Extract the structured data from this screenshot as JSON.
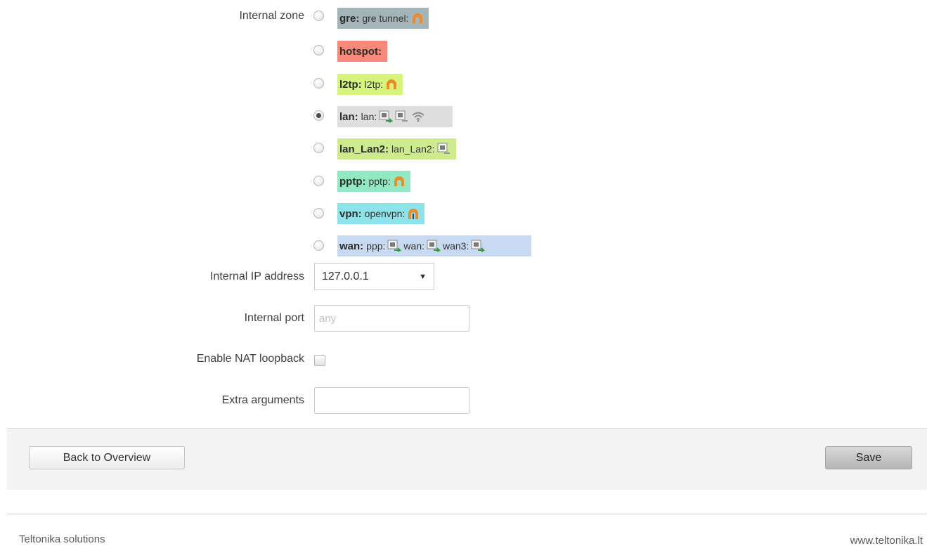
{
  "form": {
    "internal_zone_label": "Internal zone",
    "zones": [
      {
        "name": "gre:",
        "detail": "gre tunnel:",
        "color": "#a3b5b8",
        "icons": [
          "tunnel-icon"
        ],
        "checked": false
      },
      {
        "name": "hotspot:",
        "detail": "",
        "color": "#f7897a",
        "icons": [],
        "checked": false
      },
      {
        "name": "l2tp:",
        "detail": "l2tp:",
        "color": "#d6f57d",
        "icons": [
          "tunnel-icon"
        ],
        "checked": false
      },
      {
        "name": "lan:",
        "detail": "lan:",
        "color": "#dedede",
        "icons": [
          "ethernet-port-icon",
          "ethernet-port-icon",
          "wifi-icon"
        ],
        "checked": true
      },
      {
        "name": "lan_Lan2:",
        "detail": "lan_Lan2:",
        "color": "#cdea8c",
        "icons": [
          "ethernet-port-icon"
        ],
        "checked": false
      },
      {
        "name": "pptp:",
        "detail": "pptp:",
        "color": "#91e8c3",
        "icons": [
          "tunnel-icon"
        ],
        "checked": false
      },
      {
        "name": "vpn:",
        "detail": "openvpn:",
        "color": "#8ce4ea",
        "icons": [
          "vpn-tunnel-icon"
        ],
        "checked": false
      },
      {
        "name": "wan:",
        "detail": "ppp:",
        "detail2": "wan:",
        "detail3": "wan3:",
        "color": "#c8daf2",
        "icons": [
          "ethernet-port-icon",
          "ethernet-port-icon",
          "ethernet-port-icon"
        ],
        "checked": false
      }
    ],
    "internal_ip_label": "Internal IP address",
    "internal_ip_value": "127.0.0.1",
    "internal_port_label": "Internal port",
    "internal_port_placeholder": "any",
    "nat_loopback_label": "Enable NAT loopback",
    "nat_loopback_checked": false,
    "extra_args_label": "Extra arguments",
    "extra_args_value": ""
  },
  "actions": {
    "back_label": "Back to Overview",
    "save_label": "Save"
  },
  "footer": {
    "left_text": "Teltonika solutions",
    "right_text": "www.teltonika.lt"
  }
}
